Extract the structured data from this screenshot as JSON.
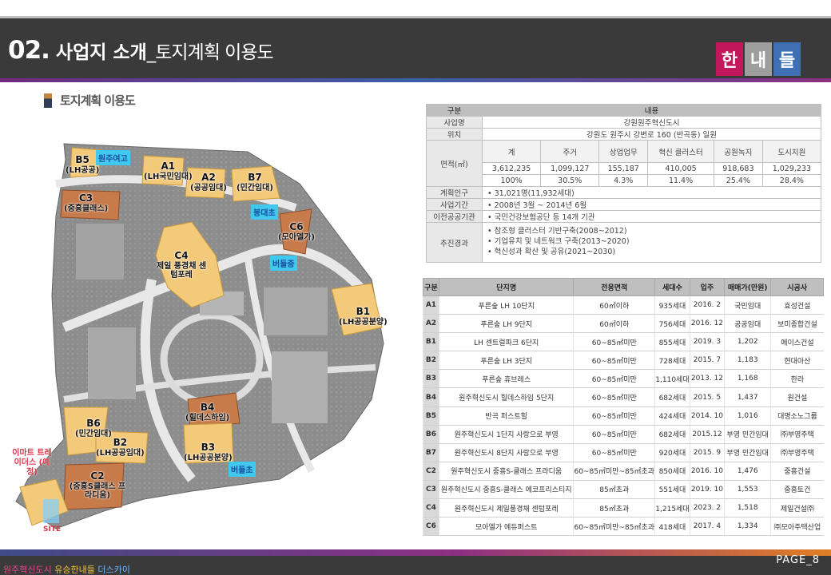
{
  "header": {
    "number": "02.",
    "title_main": "사업지 소개",
    "title_sub": "_토지계획 이용도",
    "badges": [
      {
        "char": "한",
        "color": "#c2185b"
      },
      {
        "char": "내",
        "color": "#9e9e9e"
      },
      {
        "char": "들",
        "color": "#3f6fb5"
      }
    ]
  },
  "section_title": "토지계획 이용도",
  "map": {
    "lots": [
      {
        "id": "B5",
        "desc": "(LH공공)"
      },
      {
        "id": "A1",
        "desc": "(LH국민임대)"
      },
      {
        "id": "A2",
        "desc": "(공공임대)"
      },
      {
        "id": "B7",
        "desc": "(민간임대)"
      },
      {
        "id": "C3",
        "desc": "(중흥클래스)"
      },
      {
        "id": "C6",
        "desc": "(모아엘가)"
      },
      {
        "id": "C4",
        "desc": "제일 풍경채 센텀포레"
      },
      {
        "id": "B1",
        "desc": "(LH공공분양)"
      },
      {
        "id": "B4",
        "desc": "(힐데스하임)"
      },
      {
        "id": "B6",
        "desc": "(민간임대)"
      },
      {
        "id": "B2",
        "desc": "(LH공공임대)"
      },
      {
        "id": "B3",
        "desc": "(LH공공분양)"
      },
      {
        "id": "C2",
        "desc": "(중흥S클래스 프라디움)"
      }
    ],
    "schools": [
      "원주여고",
      "봉대초",
      "버들중",
      "버들초"
    ],
    "emart": "이마트 트레이더스 (예정)",
    "site": "SITE"
  },
  "info_table": {
    "header": [
      "구분",
      "내용"
    ],
    "business_name_label": "사업명",
    "business_name": "강원원주혁신도시",
    "location_label": "위치",
    "location": "강원도 원주시 강변로 160 (반곡동) 일원",
    "area_label": "면적(㎡)",
    "area_cols": [
      "계",
      "주거",
      "상업업무",
      "혁신 클러스터",
      "공원녹지",
      "도시지원"
    ],
    "area_values": [
      "3,612,235",
      "1,099,127",
      "155,187",
      "410,005",
      "918,683",
      "1,029,233"
    ],
    "area_pct": [
      "100%",
      "30.5%",
      "4.3%",
      "11.4%",
      "25.4%",
      "28.4%"
    ],
    "population_label": "계획인구",
    "population": "• 31,021명(11,932세대)",
    "period_label": "사업기간",
    "period": "• 2008년 3월 ~ 2014년 6월",
    "agencies_label": "이전공공기관",
    "agencies": "• 국민건강보험공단 등 14개 기관",
    "progress_label": "추진경과",
    "progress": [
      "• 참조형 클러스터 기반구축(2008~2012)",
      "• 기업유치 및 네트워크 구축(2013~2020)",
      "• 혁신성과 확산 및 공유(2021~2030)"
    ]
  },
  "complex_table": {
    "headers": [
      "구분",
      "단지명",
      "전용면적",
      "세대수",
      "입주",
      "매매가(만원)",
      "시공사"
    ],
    "rows": [
      [
        "A1",
        "푸른숲 LH 10단지",
        "60㎡이하",
        "935세대",
        "2016. 2",
        "국민임대",
        "효성건설"
      ],
      [
        "A2",
        "푸른숲 LH 9단지",
        "60㎡이하",
        "756세대",
        "2016. 12",
        "공공임대",
        "보미종합건설"
      ],
      [
        "B1",
        "LH 센트럴파크 6단지",
        "60~85㎡미만",
        "855세대",
        "2019. 3",
        "1,202",
        "에이스건설"
      ],
      [
        "B2",
        "푸른숲 LH 3단지",
        "60~85㎡미만",
        "728세대",
        "2015. 7",
        "1,183",
        "현대아산"
      ],
      [
        "B3",
        "푸른숲 휴브레스",
        "60~85㎡미만",
        "1,110세대",
        "2013. 12",
        "1,168",
        "한라"
      ],
      [
        "B4",
        "원주혁신도시 힐데스하임 5단지",
        "60~85㎡미만",
        "682세대",
        "2015. 5",
        "1,437",
        "원건설"
      ],
      [
        "B5",
        "반곡 퍼스트힐",
        "60~85㎡미만",
        "424세대",
        "2014. 10",
        "1,016",
        "대명소노그룹"
      ],
      [
        "B6",
        "원주혁신도시 1단지 사랑으로 부영",
        "60~85㎡미만",
        "682세대",
        "2015.12",
        "부영 민간임대",
        "㈜부영주택"
      ],
      [
        "B7",
        "원주혁신도시 8단지 사랑으로 부영",
        "60~85㎡미만",
        "920세대",
        "2015. 9",
        "부영 민간임대",
        "㈜부영주택"
      ],
      [
        "C2",
        "원주혁신도시 중흥S-클래스 프라디움",
        "60~85㎡미만~85㎡초과",
        "850세대",
        "2016. 10",
        "1,476",
        "중흥건설"
      ],
      [
        "C3",
        "원주혁신도시 중흥S-클래스 에코프리스티지",
        "85㎡초과",
        "551세대",
        "2019. 10",
        "1,553",
        "중흥토건"
      ],
      [
        "C4",
        "원주혁신도시 제일풍경채 센텀포레",
        "85㎡초과",
        "1,215세대",
        "2023. 2",
        "1,518",
        "제일건설㈜"
      ],
      [
        "C6",
        "모아엘가 에듀퍼스트",
        "60~85㎡미만~85㎡초과",
        "418세대",
        "2017. 4",
        "1,334",
        "㈜모아주택산업"
      ]
    ]
  },
  "footer": {
    "slogan_parts": [
      {
        "text": "원주혁신도시 ",
        "color": "#e04a8a"
      },
      {
        "text": "유승한내들 ",
        "color": "#f0c23b"
      },
      {
        "text": "더스카이",
        "color": "#6fb7ff"
      }
    ],
    "page": "PAGE_8"
  }
}
